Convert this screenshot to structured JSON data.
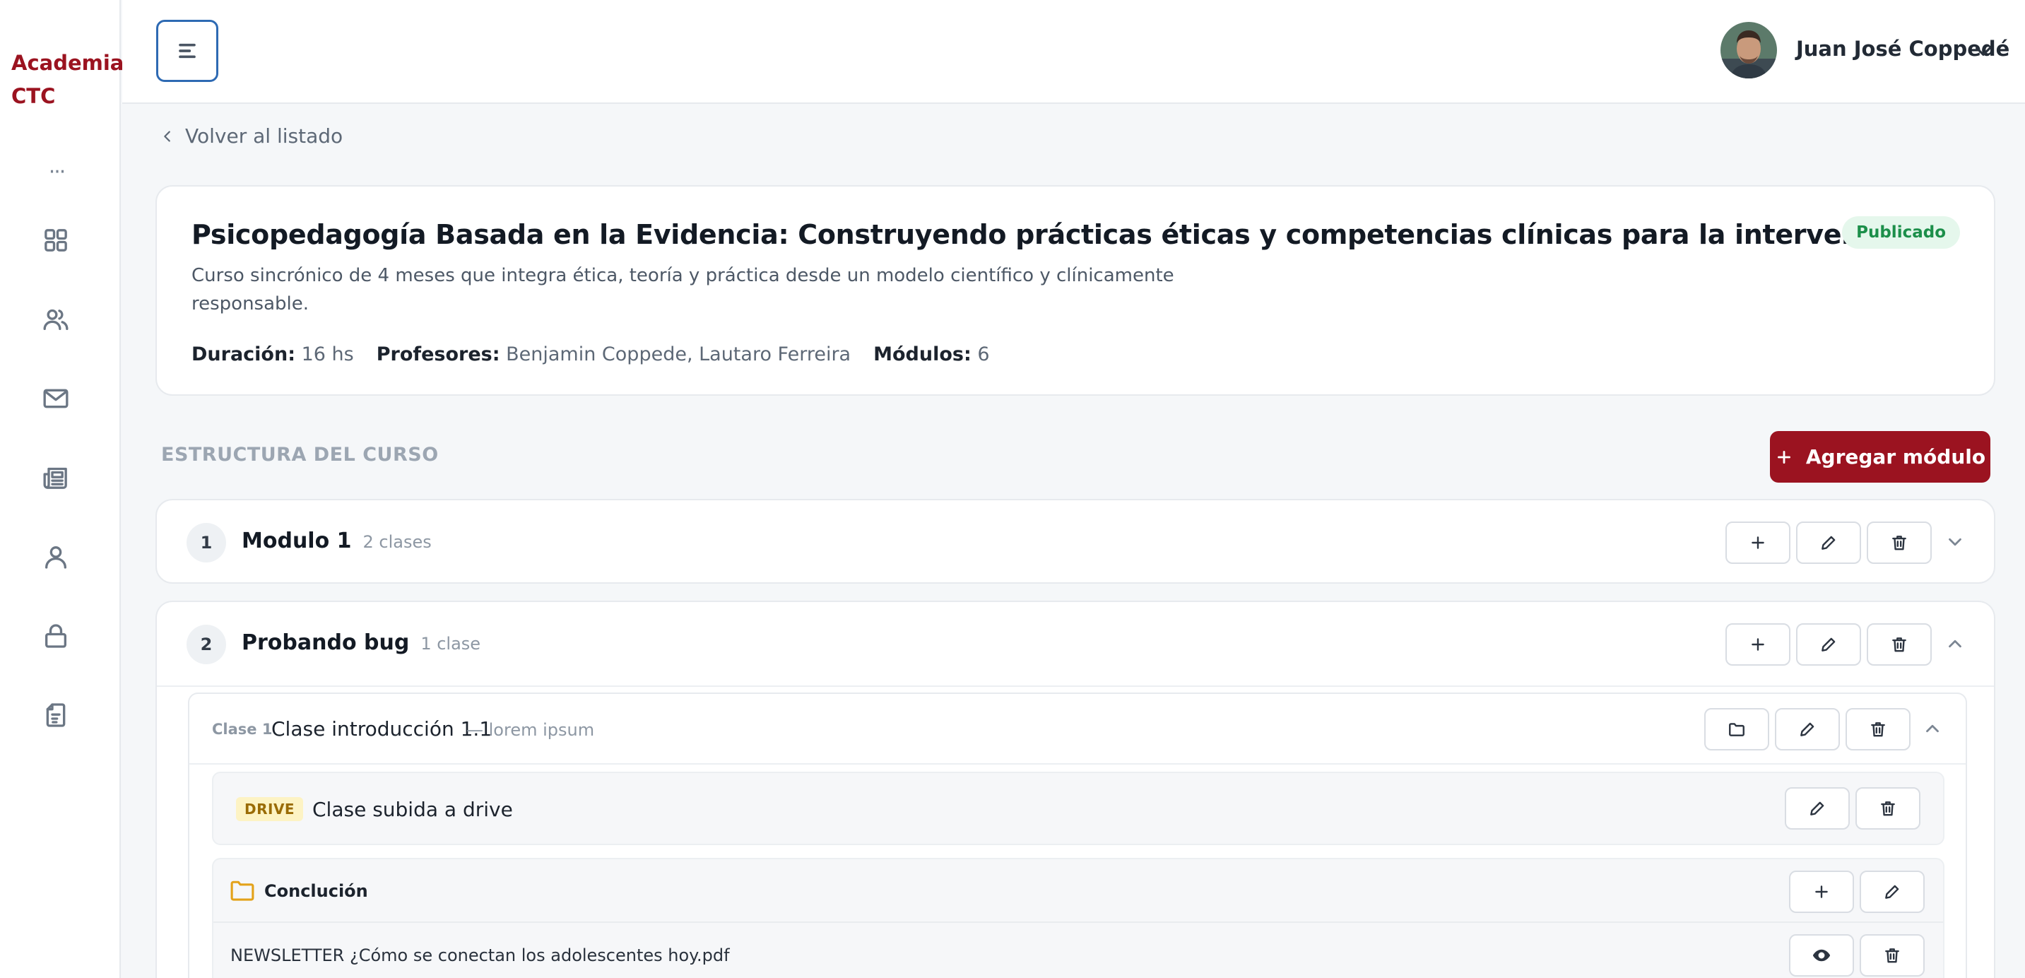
{
  "sidebar": {
    "logo": "Academia\nCTC",
    "logo_line1": "Academia",
    "logo_line2": "CTC",
    "more_icon": "more-dots-icon",
    "items": [
      {
        "name": "dashboard",
        "icon": "grid-icon"
      },
      {
        "name": "users",
        "icon": "users-icon"
      },
      {
        "name": "messages",
        "icon": "mail-icon"
      },
      {
        "name": "newsletter",
        "icon": "newspaper-icon"
      },
      {
        "name": "profile",
        "icon": "user-icon"
      },
      {
        "name": "security",
        "icon": "lock-icon"
      },
      {
        "name": "documents",
        "icon": "document-icon"
      }
    ]
  },
  "header": {
    "user_name": "Juan José Coppedé"
  },
  "back_label": "Volver al listado",
  "course": {
    "title": "Psicopedagogía Basada en la Evidencia: Construyendo prácticas éticas y competencias clínicas para la intervención",
    "status": "Publicado",
    "description": "Curso sincrónico de 4 meses que integra ética, teoría y práctica desde un modelo científico y clínicamente responsable.",
    "duration_label": "Duración:",
    "duration_value": "16 hs",
    "teachers_label": "Profesores:",
    "teachers_value": "Benjamin Coppede, Lautaro Ferreira",
    "modules_label": "Módulos:",
    "modules_value": "6"
  },
  "structure": {
    "title": "ESTRUCTURA DEL CURSO",
    "add_module_label": "Agregar módulo"
  },
  "modules": [
    {
      "number": "1",
      "title": "Modulo 1",
      "count": "2 clases"
    },
    {
      "number": "2",
      "title": "Probando bug",
      "count": "1 clase"
    }
  ],
  "clase": {
    "label": "Clase 1",
    "title": "Clase introducción 1.1",
    "subtitle": "— lorem ipsum",
    "drive_tag": "DRIVE",
    "drive_title": "Clase subida a drive",
    "folder_title": "Conclución",
    "file_name": "NEWSLETTER ¿Cómo se conectan los adolescentes hoy.pdf"
  },
  "colors": {
    "brand": "#9b1320",
    "published_bg": "#e5f7ec",
    "published_text": "#1c8f4a",
    "drive_bg": "#fdf3c4",
    "folder": "#e3a21a"
  }
}
